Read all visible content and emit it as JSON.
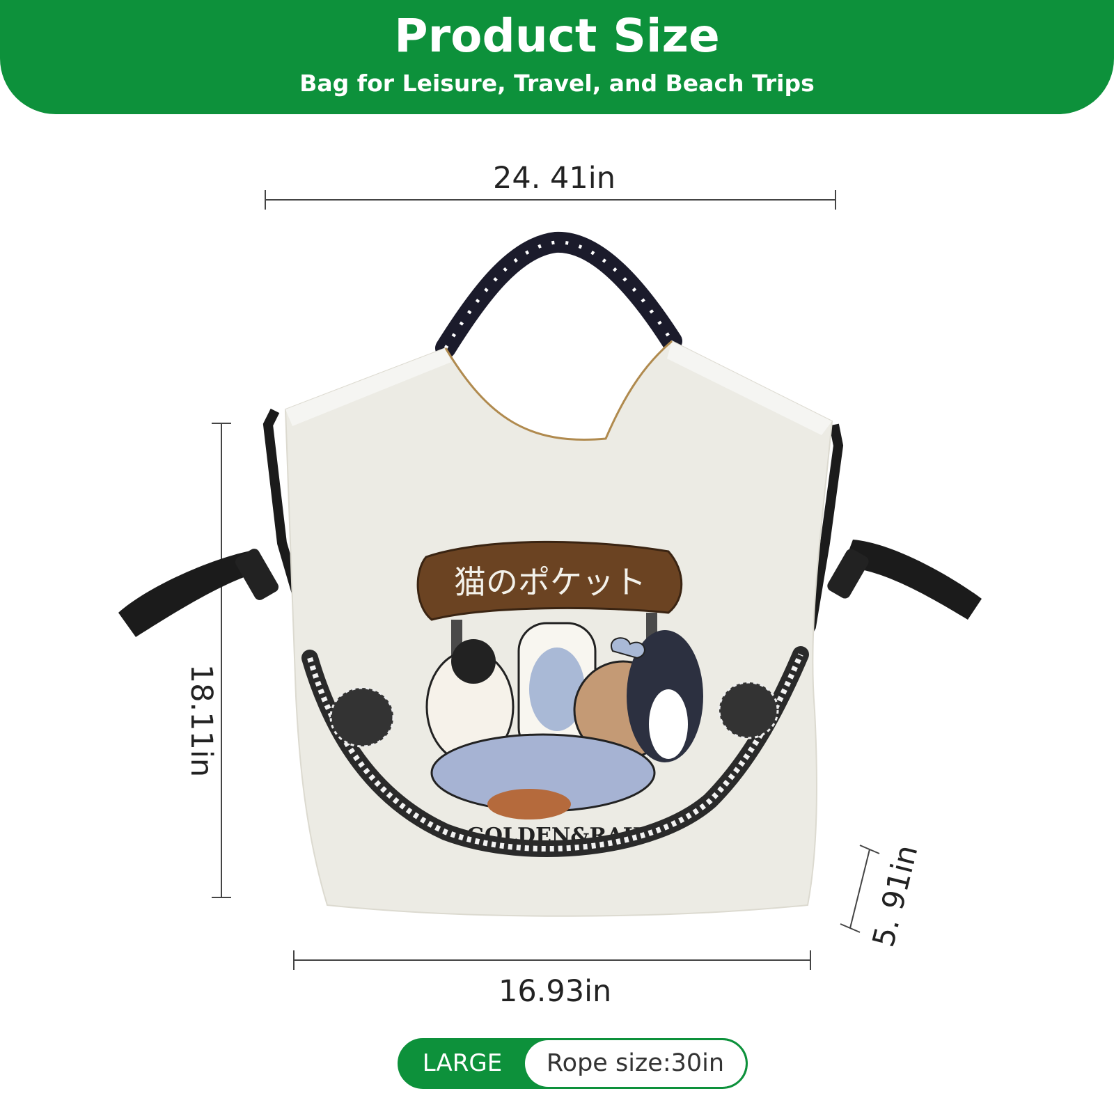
{
  "header": {
    "title": "Product Size",
    "subtitle": "Bag for Leisure, Travel, and Beach Trips"
  },
  "dimensions": {
    "top_width": "24. 41in",
    "height": "18.11in",
    "depth": "5. 91in",
    "bottom_width": "16.93in"
  },
  "badge": {
    "size_label": "LARGE",
    "rope_label": "Rope size:30in"
  },
  "colors": {
    "brand_green": "#0d913b",
    "bag_body": "#eceae2",
    "strap": "#1b1b1b",
    "patch_brown": "#6b4322"
  },
  "embroidery": {
    "sign_text": "猫のポケット",
    "brand_text": "GOLDEN&RAIL"
  }
}
